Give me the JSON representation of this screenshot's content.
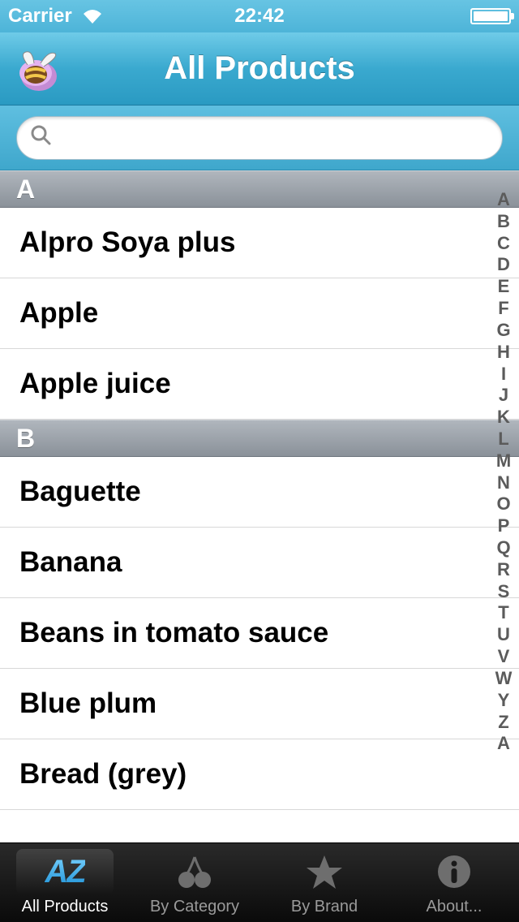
{
  "status": {
    "carrier": "Carrier",
    "time": "22:42"
  },
  "nav": {
    "title": "All Products"
  },
  "search": {
    "placeholder": ""
  },
  "sections": [
    {
      "letter": "A",
      "items": [
        "Alpro Soya plus",
        "Apple",
        "Apple juice"
      ]
    },
    {
      "letter": "B",
      "items": [
        "Baguette",
        "Banana",
        "Beans in tomato sauce",
        "Blue plum",
        "Bread (grey)"
      ]
    }
  ],
  "index_letters": [
    "A",
    "B",
    "C",
    "D",
    "E",
    "F",
    "G",
    "H",
    "I",
    "J",
    "K",
    "L",
    "M",
    "N",
    "O",
    "P",
    "Q",
    "R",
    "S",
    "T",
    "U",
    "V",
    "W",
    "Y",
    "Z",
    "A"
  ],
  "tabs": {
    "items": [
      {
        "label": "All Products",
        "icon": "az",
        "active": true
      },
      {
        "label": "By Category",
        "icon": "cherries",
        "active": false
      },
      {
        "label": "By Brand",
        "icon": "star",
        "active": false
      },
      {
        "label": "About...",
        "icon": "info",
        "active": false
      }
    ]
  }
}
